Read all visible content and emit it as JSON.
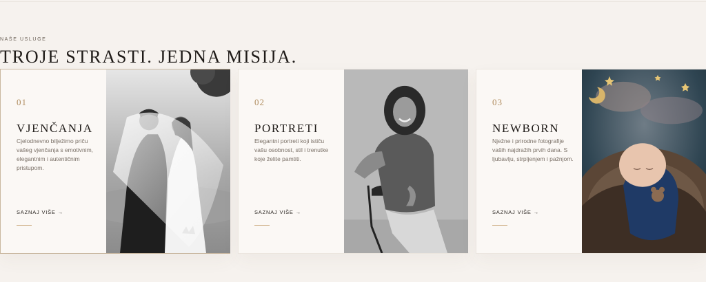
{
  "section": {
    "eyebrow": "NAŠE USLUGE",
    "headline": "TROJE STRASTI. JEDNA MISIJA."
  },
  "services": [
    {
      "number": "01",
      "title": "VJENČANJA",
      "description": "Cjelodnevno bilježimo priču vašeg vjenčanja s emotivnim, elegantnim i autentičnim pristupom.",
      "cta": "SAZNAJ VIŠE →",
      "image": "wedding-couple-photo"
    },
    {
      "number": "02",
      "title": "PORTRETI",
      "description": "Elegantni portreti koji ističu vašu osobnost, stil i trenutke koje želite pamtiti.",
      "cta": "SAZNAJ VIŠE →",
      "image": "portrait-photo"
    },
    {
      "number": "03",
      "title": "NEWBORN",
      "description": "Nježne i prirodne fotografije vaših najdražih prvih dana. S ljubavlju, strpljenjem i pažnjom.",
      "cta": "SAZNAJ VIŠE →",
      "image": "newborn-photo"
    }
  ],
  "colors": {
    "background": "#f6f2ee",
    "card": "#fbf8f5",
    "accent": "#b08d5f",
    "text": "#1f1b18"
  }
}
